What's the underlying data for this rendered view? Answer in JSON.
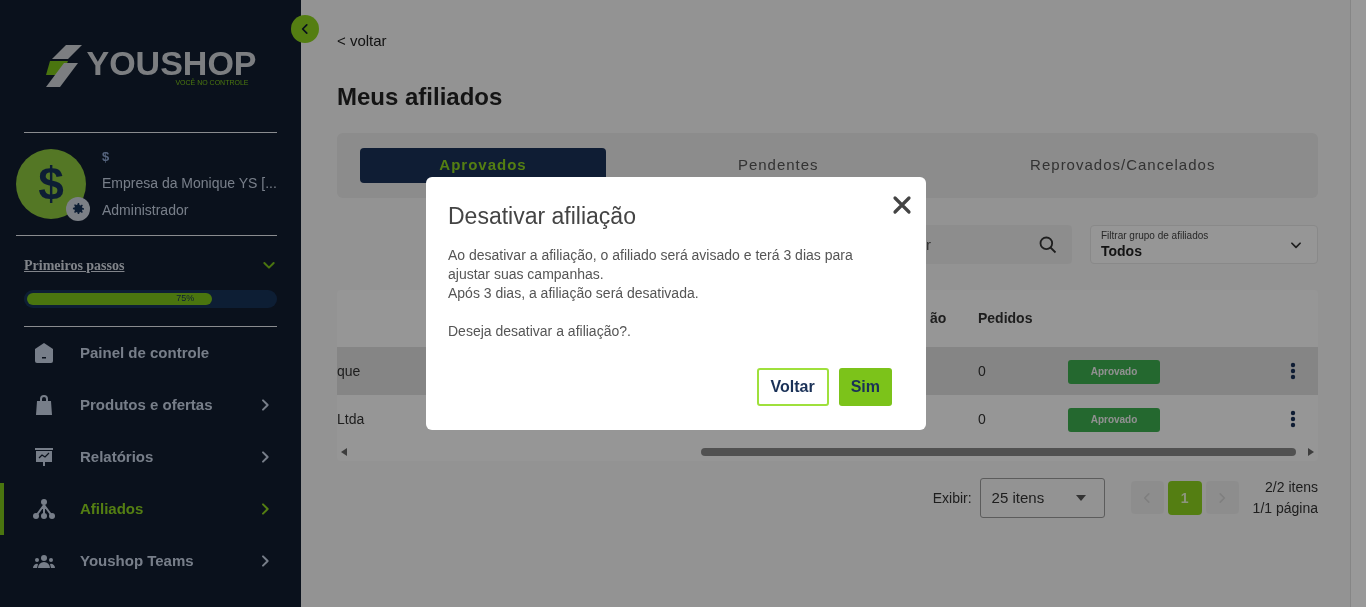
{
  "sidebar": {
    "logo": {
      "name": "YOUSHOP",
      "tagline": "VOCÊ NO CONTROLE"
    },
    "account": {
      "symbol": "$",
      "company": "Empresa da Monique YS [...",
      "role": "Administrador"
    },
    "onboarding": {
      "title": "Primeiros passos",
      "expanded": true,
      "level": 0.75,
      "label": "75%"
    },
    "menu": [
      {
        "label": "Painel de controle",
        "kind": "home",
        "has_submenu": false,
        "selected": false
      },
      {
        "label": "Produtos e ofertas",
        "kind": "bag",
        "has_submenu": true,
        "selected": false
      },
      {
        "label": "Relatórios",
        "kind": "chart",
        "has_submenu": true,
        "selected": false
      },
      {
        "label": "Afiliados",
        "kind": "network",
        "has_submenu": true,
        "selected": true
      },
      {
        "label": "Youshop Teams",
        "kind": "team",
        "has_submenu": true,
        "selected": false
      }
    ]
  },
  "main": {
    "back_link": "< voltar",
    "title": "Meus afiliados",
    "tabs": [
      {
        "label": "Aprovados",
        "selected": true
      },
      {
        "label": "Pendentes",
        "selected": false
      },
      {
        "label": "Reprovados/Cancelados",
        "selected": false
      }
    ],
    "search": {
      "placeholder": "r"
    },
    "group_filter": {
      "label": "Filtrar grupo de afiliados",
      "value": "Todos"
    },
    "table": {
      "columns": [
        "ão",
        "Pedidos"
      ],
      "rows": [
        {
          "name": "que",
          "orders": "0",
          "status": "Aprovado",
          "highlighted": true
        },
        {
          "name": "Ltda",
          "orders": "0",
          "status": "Aprovado",
          "highlighted": false
        }
      ]
    },
    "pagination": {
      "show_label": "Exibir:",
      "page_size": "25 itens",
      "pages": [
        {
          "label": "1",
          "selected": true
        }
      ],
      "items": "2/2 itens",
      "page_info": "1/1 página"
    }
  },
  "modal": {
    "title": "Desativar afiliação",
    "paragraphs": [
      [
        "Ao desativar a afiliação, o afiliado será avisado e terá 3 dias para ajustar suas campanhas.",
        "Após 3 dias, a afiliação será desativada."
      ],
      [
        "Deseja desativar a afiliação?."
      ]
    ],
    "buttons": [
      {
        "label": "Voltar",
        "kind": "secondary"
      },
      {
        "label": "Sim",
        "kind": "primary"
      }
    ]
  }
}
